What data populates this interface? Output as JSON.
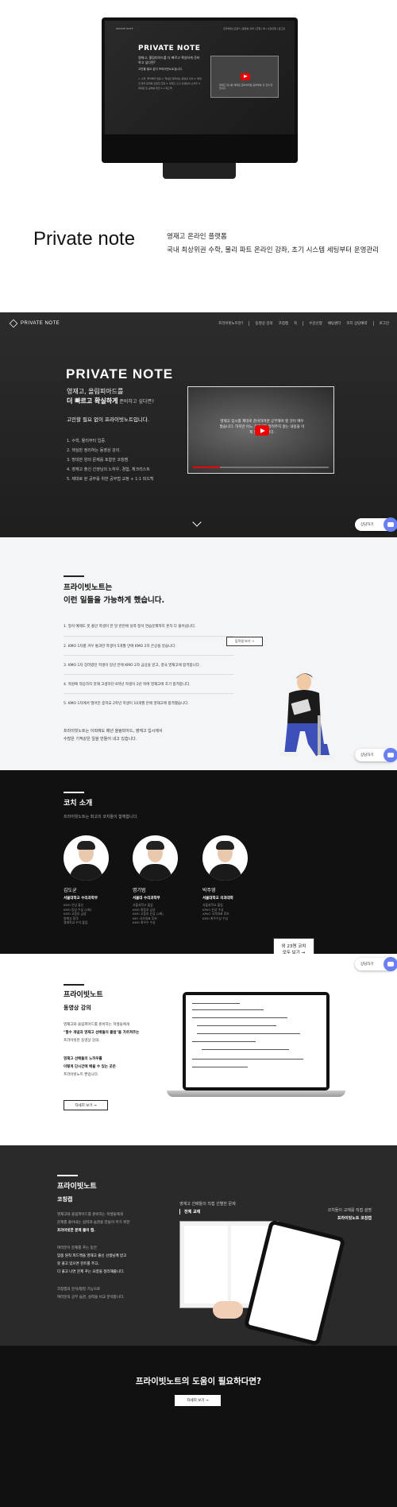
{
  "mockup": {
    "nav_logo": "PRIVATE NOTE",
    "nav_items": "프라이빗노트란?  |  동영상 강의  |  코칭  |  북  |  수강신청  |  로그인",
    "title": "PRIVATE NOTE",
    "sub": "영재고, 올림피아드를 더 빠르고 확실하게 준비하고 싶다면?",
    "tag": "고민할 필요 없이 프라이빗노트입니다.",
    "list": "1. 수학, 물리부터 입증  2. 핵심만 정리하는 동영상 강의  3. 방대한 양의 문제를 포함한 코칭  4. 영재고 출신 선생님의 노하우  5. 제대로 된 공부를 위한 1:1 피드백",
    "video_caption": "영재고 입시를 제대로 준비하려면 공부해야 할 것이 많습니다"
  },
  "intro": {
    "title": "Private note",
    "line1": "영재고 온라인 플랫폼",
    "line2": "국내 최상위권 수학, 물리 파트 온라인 강좌, 초기 시스템 세팅부터 운영관리"
  },
  "hero": {
    "logo": "PRIVATE NOTE",
    "nav": [
      "프라이빗노트란?",
      "동영상 강의",
      "코칭캠",
      "북",
      "수강신청",
      "채팅센터",
      "코치 상담예약",
      "로그인"
    ],
    "title": "PRIVATE NOTE",
    "sub1": "영재고, 올림피아드를",
    "sub2_main": "더 빠르고 확실하게",
    "sub2_small": " 준비하고 싶다면?",
    "tag": "고민할 필요 없이 프라이빗노트입니다.",
    "list": [
      "1. 수학, 물리부터 입증.",
      "2. 핵심만 정리하는 동영상 강의.",
      "3. 방대한 양의 문제를 포함한 코칭캠",
      "4. 영재고 출신 선생님의 노하우, 경험, 체크리스트",
      "5. 제대로 된 공부를 위한 공부법 교정 + 1:1 피드백"
    ],
    "video_caption": "영재고 입시를 제대로 준비하려면 공부해야 할 것이 매우 많습니다. 하지만 어느 곳에서도 알려주지 않는 내용을 이제 알려드립니다.",
    "consult": "상담하기"
  },
  "can": {
    "title1": "프라이빗노트는",
    "title2": "이런 일들을 가능하게 했습니다.",
    "items": [
      "1. 정석 예제도 못 풀던 학생이 한 달 반만에 실력 정석 연습문제까지 혼자 다 풀어냅니다.",
      "2. KMO 1차를 겨우 통과한 학생이 5개월 만에 KMO 2차 은상을 받습니다.",
      "3. KMO 1차 장려였던 학생이 일년 만에 KMO 2차 금상을 받고, 결국 영재고에 합격합니다.",
      "4. 학원에 적응하지 못해 고생하던 6학년 학생이 2년 뒤에 영재고에 조기 합격합니다.",
      "5. KMO 1차에서 떨어진 중학교 2학년 학생이 10개월 만에 영재고에 합격했습니다."
    ],
    "button": "입학생 보기 →",
    "foot1": "프라이빗노트는 이외에도 매년 올림피아드, 영재고 입시에서",
    "foot2": "수많은 기적같은 일을 만들어 내고 있습니다.",
    "consult": "상담하기"
  },
  "coach": {
    "title": "코치 소개",
    "sub": "프라이빗노트는 최고의 코치들이 함께합니다.",
    "people": [
      {
        "name": "김도균",
        "school": "서울대학교 수리과학부",
        "creds": [
          "KMO 은상 출신",
          "KMO 동상 수상 (2회)",
          "KMO 고등부 금상",
          "영재고 합격",
          "영재학교 수석 졸업"
        ]
      },
      {
        "name": "명기범",
        "school": "서울대 수리과학부",
        "creds": [
          "서울과학고 졸업",
          "KMO 중등부 금상",
          "KMO 고등부 은상 (2회)",
          "IMO 국가대표 후보",
          "KMO 최우수 수상"
        ]
      },
      {
        "name": "박주영",
        "school": "서울대학교 의과대학",
        "creds": [
          "서울과학고 졸업",
          "KPhO 은상 수상",
          "APhO 국가대표 후보",
          "KMO 최우수상 수상"
        ]
      }
    ],
    "more_line1": "외 23명 코치",
    "more_line2": "모두 보기 →"
  },
  "lecture": {
    "title": "프라이빗노트",
    "subtitle": "동영상 강의",
    "p1": "영재고와 올림피아드를 준비하는 학생들에게",
    "p2": "\"필수 개념과 영재고 선배들의 풀법\"을 가르쳐주는",
    "p3": "프라이빗한 동영상 강의.",
    "p4": "영재고 선배들의 노하우를",
    "p5": "이렇게 단시간에 배울 수 있는 곳은",
    "p6": "프라이빗노트 뿐입니다.",
    "button": "자세히 보기 →",
    "consult": "상담하기"
  },
  "coaching": {
    "title": "프라이빗노트",
    "subtitle": "코칭캡",
    "p1": "영재고와 올림피아드를 준비하는 학생들에게",
    "p2": "문제를 풀어내는 실력과 습관을 만들어 주기 위한",
    "p3": "프라이빗한 문제 풀이 캡.",
    "p4": "여러분이 문제를 푸는 동안",
    "p5": "맞춤 원칙 피드백을 영재고 출신 선생님께 받고",
    "p6": "못 풀고 있으면 힌트를 주고,",
    "p7": "다 풀고 나면 문제 푸는 요령을 정리해줍니다.",
    "p8": "코칭캡의 분석/평정 기능으로",
    "p9": "여러분의 공부 습관, 실력을 비교 분석합니다.",
    "label1": "영재고 선배들의 직접 선별한 문제",
    "label1b": "전체 교재",
    "label2": "코치들이 교재를 직접 설명",
    "label2b": "프라이빗노트 코칭캡"
  },
  "help": {
    "title": "프라이빗노트의 도움이 필요하다면?",
    "button": "자세히 보기 →"
  }
}
